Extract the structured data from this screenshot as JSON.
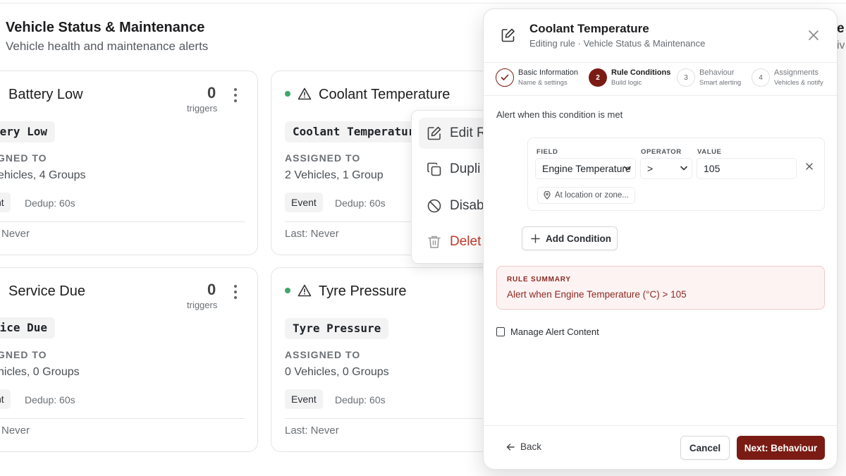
{
  "page": {
    "title": "Vehicle Status & Maintenance",
    "subtitle": "Vehicle health and maintenance alerts",
    "edge_title_fragment": "e",
    "edge_subtitle_fragment": "iv"
  },
  "cards": [
    {
      "title": "Battery Low",
      "count": "0",
      "count_label": "triggers",
      "tag": "tery Low",
      "assigned_label": "GNED TO",
      "assigned_value": "ehicles, 4 Groups",
      "type_chip": "nt",
      "dedup": "Dedup: 60s",
      "last": "Never"
    },
    {
      "title": "Coolant Temperature",
      "tag": "Coolant Temperature",
      "assigned_label": "ASSIGNED TO",
      "assigned_value": "2 Vehicles, 1 Group",
      "type_chip": "Event",
      "dedup": "Dedup: 60s",
      "last": "Last: Never"
    },
    {
      "title": "Service Due",
      "count": "0",
      "count_label": "triggers",
      "tag": "vice Due",
      "assigned_label": "GNED TO",
      "assigned_value": "hicles, 0 Groups",
      "type_chip": "nt",
      "dedup": "Dedup: 60s",
      "last": "Never"
    },
    {
      "title": "Tyre Pressure",
      "tag": "Tyre Pressure",
      "assigned_label": "ASSIGNED TO",
      "assigned_value": "0 Vehicles, 0 Groups",
      "type_chip": "Event",
      "dedup": "Dedup: 60s",
      "last": "Last: Never"
    }
  ],
  "context_menu": {
    "items": [
      {
        "label": "Edit R",
        "icon": "edit-icon"
      },
      {
        "label": "Dupli",
        "icon": "duplicate-icon"
      },
      {
        "label": "Disab",
        "icon": "disable-icon"
      },
      {
        "label": "Delet",
        "icon": "trash-icon"
      }
    ]
  },
  "panel": {
    "title": "Coolant Temperature",
    "subtitle": "Editing rule · Vehicle Status & Maintenance",
    "steps": [
      {
        "number": "",
        "title": "Basic Information",
        "desc": "Name & settings",
        "state": "done"
      },
      {
        "number": "2",
        "title": "Rule Conditions",
        "desc": "Build logic",
        "state": "active"
      },
      {
        "number": "3",
        "title": "Behaviour",
        "desc": "Smart alerting",
        "state": "todo"
      },
      {
        "number": "4",
        "title": "Assignments",
        "desc": "Vehicles & notify",
        "state": "todo"
      }
    ],
    "intro": "Alert when this condition is met",
    "condition": {
      "field_label": "FIELD",
      "field_value": "Engine Temperature",
      "operator_label": "OPERATOR",
      "operator_value": ">",
      "value_label": "VALUE",
      "value": "105",
      "location_placeholder": "At location or zone..."
    },
    "add_condition": "Add Condition",
    "summary": {
      "heading": "RULE SUMMARY",
      "text": "Alert when Engine Temperature (°C) > 105"
    },
    "manage_alert_content": "Manage Alert Content",
    "footer": {
      "back": "Back",
      "cancel": "Cancel",
      "next": "Next: Behaviour"
    }
  },
  "colors": {
    "accent": "#7a1c14",
    "status_active": "#3fa66a",
    "summary_bg": "#fdf3f3",
    "danger": "#c0392b"
  }
}
